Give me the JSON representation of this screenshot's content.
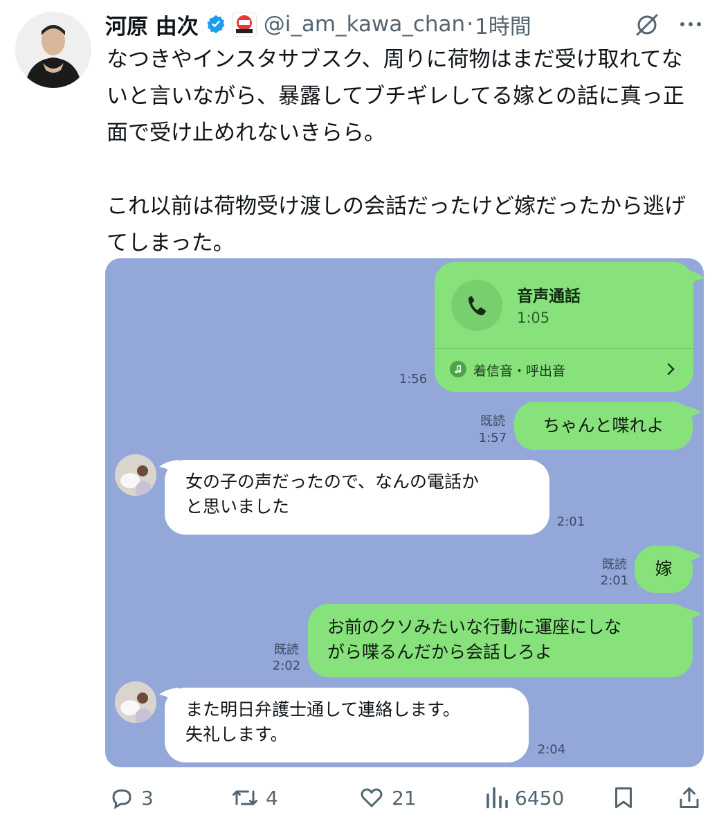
{
  "author": {
    "name": "河原 由次",
    "handle": "@i_am_kawa_chan",
    "separator": "·",
    "time": "1時間"
  },
  "tweet_text": "なつきやインスタサブスク、周りに荷物はまだ受け取れてないと言いながら、暴露してブチギレしてる嫁との話に真っ正面で受け止めれないきらら。\n\nこれ以前は荷物受け渡しの会話だったけど嫁だったから逃げてしまった。",
  "chat": {
    "call": {
      "title": "音声通話",
      "duration": "1:05",
      "ringtone": "着信音・呼出音",
      "time": "1:56"
    },
    "messages": [
      {
        "from": "me",
        "read": "既読",
        "time": "1:57",
        "text": "ちゃんと喋れよ"
      },
      {
        "from": "them",
        "time": "2:01",
        "text": "女の子の声だったので、なんの電話か\nと思いました"
      },
      {
        "from": "me",
        "read": "既読",
        "time": "2:01",
        "text": "嫁"
      },
      {
        "from": "me",
        "read": "既読",
        "time": "2:02",
        "text": "お前のクソみたいな行動に運座にしな\nがら喋るんだから会話しろよ"
      },
      {
        "from": "them",
        "time": "2:04",
        "text": "また明日弁護士通して連絡します。\n失礼します。"
      }
    ]
  },
  "actions": {
    "replies": "3",
    "reposts": "4",
    "likes": "21",
    "views": "6450"
  },
  "colors": {
    "chat_bg": "#93a8d8",
    "my_bubble": "#87e27c",
    "verified": "#1d9bf0"
  }
}
